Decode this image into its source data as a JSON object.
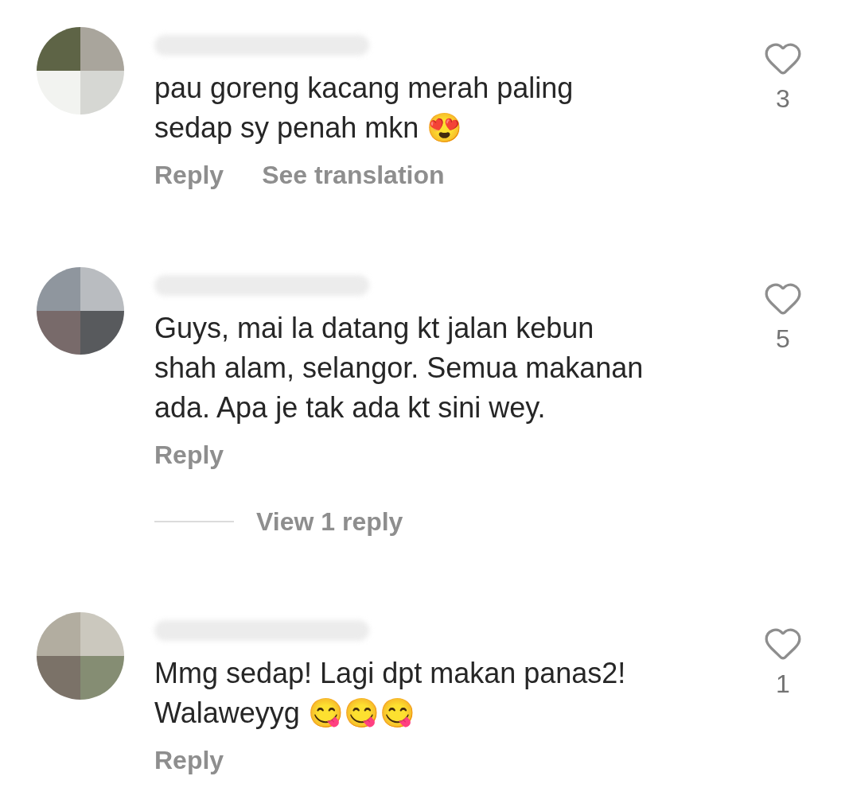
{
  "comments": [
    {
      "lines": [
        "pau goreng kacang merah paling",
        "sedap sy penah mkn 😍"
      ],
      "likes": "3",
      "liked": false,
      "actions": [
        "Reply",
        "See translation"
      ]
    },
    {
      "lines": [
        "Guys, mai la datang kt jalan kebun",
        "shah alam, selangor. Semua makanan",
        "ada. Apa je tak ada kt sini wey."
      ],
      "likes": "5",
      "liked": false,
      "actions": [
        "Reply"
      ],
      "view_replies": "View 1 reply"
    },
    {
      "lines": [
        "Mmg sedap! Lagi dpt makan panas2!",
        "Walaweyyg 😋😋😋"
      ],
      "likes": "1",
      "liked": false,
      "actions": [
        "Reply"
      ]
    }
  ]
}
